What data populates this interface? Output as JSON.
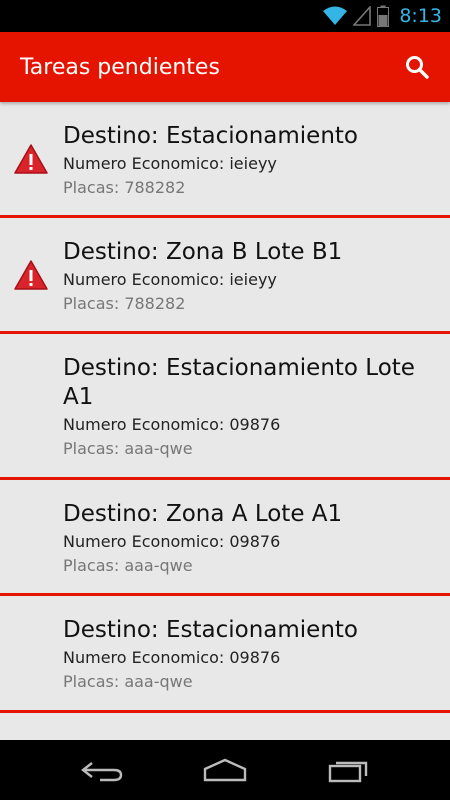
{
  "status_bar": {
    "time": "8:13"
  },
  "action_bar": {
    "title": "Tareas pendientes"
  },
  "tasks": [
    {
      "title": "Destino: Estacionamiento",
      "economic_number": "Numero Economico: ieieyy",
      "plates": "Placas: 788282",
      "warning": true
    },
    {
      "title": "Destino: Zona B Lote B1",
      "economic_number": "Numero Economico: ieieyy",
      "plates": "Placas: 788282",
      "warning": true
    },
    {
      "title": "Destino: Estacionamiento Lote A1",
      "economic_number": "Numero Economico: 09876",
      "plates": "Placas: aaa-qwe",
      "warning": false
    },
    {
      "title": "Destino: Zona A Lote A1",
      "economic_number": "Numero Economico: 09876",
      "plates": "Placas: aaa-qwe",
      "warning": false
    },
    {
      "title": "Destino: Estacionamiento",
      "economic_number": "Numero Economico: 09876",
      "plates": "Placas: aaa-qwe",
      "warning": false
    }
  ],
  "colors": {
    "accent": "#e41400",
    "status_time": "#33b5e5",
    "background": "#e8e8e8"
  },
  "icons": {
    "search": "search-icon",
    "warning": "warning-icon",
    "back": "back-icon",
    "home": "home-icon",
    "recents": "recents-icon"
  }
}
